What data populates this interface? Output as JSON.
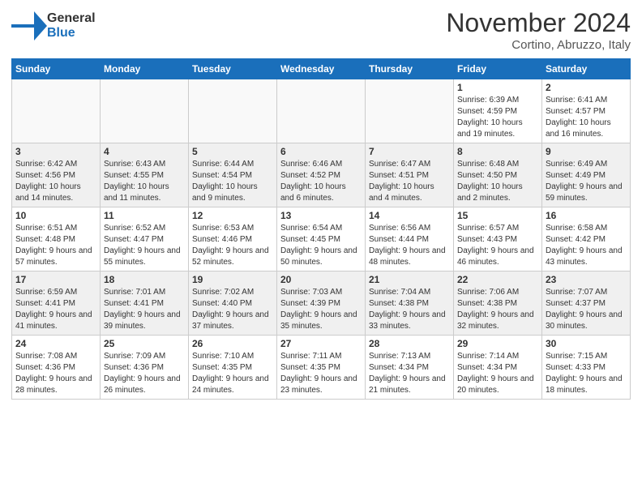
{
  "header": {
    "logo": {
      "line1": "General",
      "line2": "Blue"
    },
    "title": "November 2024",
    "location": "Cortino, Abruzzo, Italy"
  },
  "days_of_week": [
    "Sunday",
    "Monday",
    "Tuesday",
    "Wednesday",
    "Thursday",
    "Friday",
    "Saturday"
  ],
  "weeks": [
    {
      "days": [
        {
          "num": "",
          "info": ""
        },
        {
          "num": "",
          "info": ""
        },
        {
          "num": "",
          "info": ""
        },
        {
          "num": "",
          "info": ""
        },
        {
          "num": "",
          "info": ""
        },
        {
          "num": "1",
          "info": "Sunrise: 6:39 AM\nSunset: 4:59 PM\nDaylight: 10 hours and 19 minutes."
        },
        {
          "num": "2",
          "info": "Sunrise: 6:41 AM\nSunset: 4:57 PM\nDaylight: 10 hours and 16 minutes."
        }
      ]
    },
    {
      "days": [
        {
          "num": "3",
          "info": "Sunrise: 6:42 AM\nSunset: 4:56 PM\nDaylight: 10 hours and 14 minutes."
        },
        {
          "num": "4",
          "info": "Sunrise: 6:43 AM\nSunset: 4:55 PM\nDaylight: 10 hours and 11 minutes."
        },
        {
          "num": "5",
          "info": "Sunrise: 6:44 AM\nSunset: 4:54 PM\nDaylight: 10 hours and 9 minutes."
        },
        {
          "num": "6",
          "info": "Sunrise: 6:46 AM\nSunset: 4:52 PM\nDaylight: 10 hours and 6 minutes."
        },
        {
          "num": "7",
          "info": "Sunrise: 6:47 AM\nSunset: 4:51 PM\nDaylight: 10 hours and 4 minutes."
        },
        {
          "num": "8",
          "info": "Sunrise: 6:48 AM\nSunset: 4:50 PM\nDaylight: 10 hours and 2 minutes."
        },
        {
          "num": "9",
          "info": "Sunrise: 6:49 AM\nSunset: 4:49 PM\nDaylight: 9 hours and 59 minutes."
        }
      ]
    },
    {
      "days": [
        {
          "num": "10",
          "info": "Sunrise: 6:51 AM\nSunset: 4:48 PM\nDaylight: 9 hours and 57 minutes."
        },
        {
          "num": "11",
          "info": "Sunrise: 6:52 AM\nSunset: 4:47 PM\nDaylight: 9 hours and 55 minutes."
        },
        {
          "num": "12",
          "info": "Sunrise: 6:53 AM\nSunset: 4:46 PM\nDaylight: 9 hours and 52 minutes."
        },
        {
          "num": "13",
          "info": "Sunrise: 6:54 AM\nSunset: 4:45 PM\nDaylight: 9 hours and 50 minutes."
        },
        {
          "num": "14",
          "info": "Sunrise: 6:56 AM\nSunset: 4:44 PM\nDaylight: 9 hours and 48 minutes."
        },
        {
          "num": "15",
          "info": "Sunrise: 6:57 AM\nSunset: 4:43 PM\nDaylight: 9 hours and 46 minutes."
        },
        {
          "num": "16",
          "info": "Sunrise: 6:58 AM\nSunset: 4:42 PM\nDaylight: 9 hours and 43 minutes."
        }
      ]
    },
    {
      "days": [
        {
          "num": "17",
          "info": "Sunrise: 6:59 AM\nSunset: 4:41 PM\nDaylight: 9 hours and 41 minutes."
        },
        {
          "num": "18",
          "info": "Sunrise: 7:01 AM\nSunset: 4:41 PM\nDaylight: 9 hours and 39 minutes."
        },
        {
          "num": "19",
          "info": "Sunrise: 7:02 AM\nSunset: 4:40 PM\nDaylight: 9 hours and 37 minutes."
        },
        {
          "num": "20",
          "info": "Sunrise: 7:03 AM\nSunset: 4:39 PM\nDaylight: 9 hours and 35 minutes."
        },
        {
          "num": "21",
          "info": "Sunrise: 7:04 AM\nSunset: 4:38 PM\nDaylight: 9 hours and 33 minutes."
        },
        {
          "num": "22",
          "info": "Sunrise: 7:06 AM\nSunset: 4:38 PM\nDaylight: 9 hours and 32 minutes."
        },
        {
          "num": "23",
          "info": "Sunrise: 7:07 AM\nSunset: 4:37 PM\nDaylight: 9 hours and 30 minutes."
        }
      ]
    },
    {
      "days": [
        {
          "num": "24",
          "info": "Sunrise: 7:08 AM\nSunset: 4:36 PM\nDaylight: 9 hours and 28 minutes."
        },
        {
          "num": "25",
          "info": "Sunrise: 7:09 AM\nSunset: 4:36 PM\nDaylight: 9 hours and 26 minutes."
        },
        {
          "num": "26",
          "info": "Sunrise: 7:10 AM\nSunset: 4:35 PM\nDaylight: 9 hours and 24 minutes."
        },
        {
          "num": "27",
          "info": "Sunrise: 7:11 AM\nSunset: 4:35 PM\nDaylight: 9 hours and 23 minutes."
        },
        {
          "num": "28",
          "info": "Sunrise: 7:13 AM\nSunset: 4:34 PM\nDaylight: 9 hours and 21 minutes."
        },
        {
          "num": "29",
          "info": "Sunrise: 7:14 AM\nSunset: 4:34 PM\nDaylight: 9 hours and 20 minutes."
        },
        {
          "num": "30",
          "info": "Sunrise: 7:15 AM\nSunset: 4:33 PM\nDaylight: 9 hours and 18 minutes."
        }
      ]
    }
  ]
}
